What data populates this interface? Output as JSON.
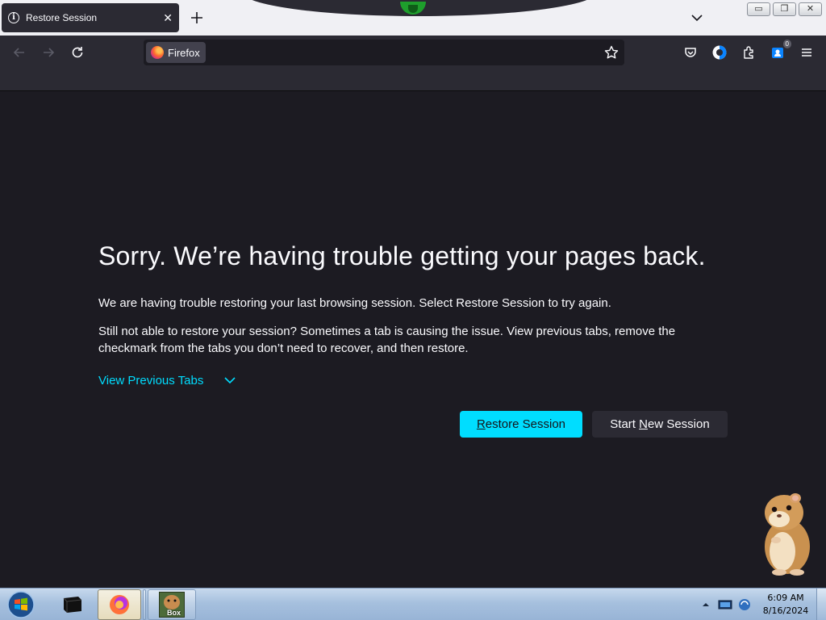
{
  "tab": {
    "title": "Restore Session"
  },
  "urlbar": {
    "identity_label": "Firefox",
    "value": ""
  },
  "toolbar": {
    "extension_badge": "0"
  },
  "page": {
    "heading": "Sorry. We’re having trouble getting your pages back.",
    "para1": "We are having trouble restoring your last browsing session. Select Restore Session to try again.",
    "para2": "Still not able to restore your session? Sometimes a tab is causing the issue. View previous tabs, remove the checkmark from the tabs you don’t need to recover, and then restore.",
    "view_previous_tabs": "View Previous Tabs",
    "restore_button": {
      "underlined": "R",
      "rest": "estore Session"
    },
    "new_session_button": {
      "before": "Start ",
      "underlined": "N",
      "after": "ew Session"
    }
  },
  "taskbar": {
    "clock_time": "6:09 AM",
    "clock_date": "8/16/2024",
    "pinned_label": "Box"
  },
  "colors": {
    "accent": "#00ddff",
    "content_bg": "#1c1b22",
    "toolbar_bg": "#2b2a33"
  },
  "icons": [
    "info-icon",
    "close-icon",
    "plus-icon",
    "chevron-down-icon",
    "back-arrow-icon",
    "forward-arrow-icon",
    "reload-icon",
    "firefox-logo-icon",
    "star-icon",
    "pocket-icon",
    "account-icon",
    "extensions-icon",
    "extension-badge-icon",
    "menu-icon",
    "windows-start-icon"
  ]
}
